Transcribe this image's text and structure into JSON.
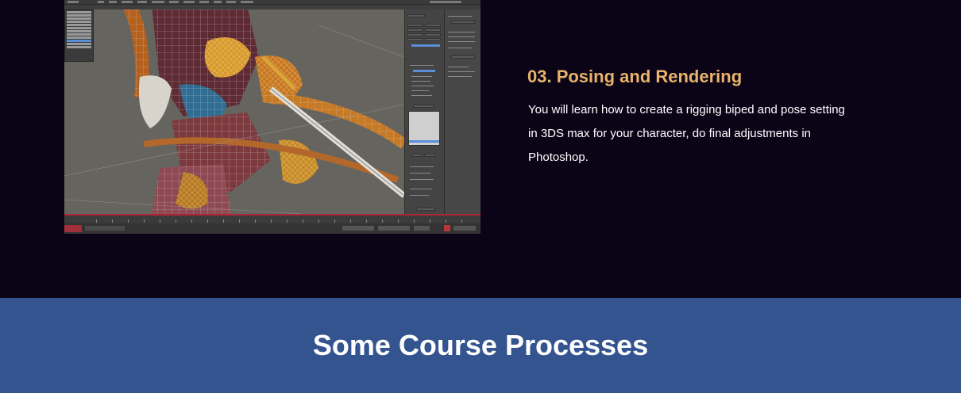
{
  "screenshot": {
    "app": "3DS Max",
    "icons": [
      "character-wireframe-viewport",
      "sword-wireframe",
      "timeline-slider"
    ],
    "colors": {
      "viewport_bg": "#6a6a68",
      "ui_dark": "#444444",
      "timeline_accent": "#b0243a",
      "selection_blue": "#5b8ed8"
    }
  },
  "section": {
    "title": "03. Posing and Rendering",
    "body": "You will learn how to create a rigging biped and pose setting in 3DS max for your character, do final adjustments in Photoshop."
  },
  "banner": {
    "heading": "Some Course Processes"
  },
  "colors": {
    "page_bg": "#0b0417",
    "title": "#e8b36a",
    "body_text": "#ffffff",
    "banner_bg": "#33548f"
  }
}
